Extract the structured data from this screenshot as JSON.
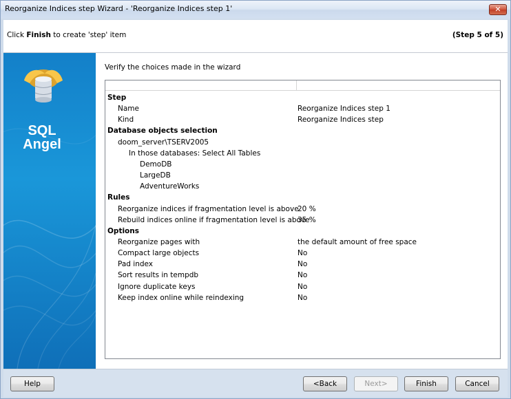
{
  "window": {
    "title": "Reorganize Indices step Wizard - 'Reorganize Indices step 1'",
    "close_glyph": "✕"
  },
  "header": {
    "instruction_prefix": "Click ",
    "instruction_bold": "Finish",
    "instruction_suffix": " to create 'step' item",
    "step_indicator": "(Step 5 of 5)"
  },
  "sidebar": {
    "logo_line1": "SQL",
    "logo_line2": "Angel",
    "logo_icon": "sql-angel-database-wings-icon"
  },
  "content": {
    "verify_text": "Verify the choices made in the wizard",
    "rows": [
      {
        "type": "section",
        "label": "Step",
        "value": ""
      },
      {
        "type": "lvl1",
        "label": "Name",
        "value": "Reorganize Indices step 1"
      },
      {
        "type": "lvl1",
        "label": "Kind",
        "value": "Reorganize Indices step"
      },
      {
        "type": "section",
        "label": "Database objects selection",
        "value": ""
      },
      {
        "type": "lvl1",
        "label": "doom_server\\TSERV2005",
        "value": ""
      },
      {
        "type": "lvl2",
        "label": "In those databases: Select All Tables",
        "value": ""
      },
      {
        "type": "lvl3",
        "label": "DemoDB",
        "value": ""
      },
      {
        "type": "lvl3",
        "label": "LargeDB",
        "value": ""
      },
      {
        "type": "lvl3",
        "label": "AdventureWorks",
        "value": ""
      },
      {
        "type": "section",
        "label": "Rules",
        "value": ""
      },
      {
        "type": "lvl1",
        "label": "Reorganize indices if fragmentation level is above",
        "value": "20 %"
      },
      {
        "type": "lvl1",
        "label": "Rebuild indices online if fragmentation level is above",
        "value": "35 %"
      },
      {
        "type": "section",
        "label": "Options",
        "value": ""
      },
      {
        "type": "lvl1",
        "label": "Reorganize pages with",
        "value": "the default amount of free space"
      },
      {
        "type": "lvl1",
        "label": "Compact large objects",
        "value": "No"
      },
      {
        "type": "lvl1",
        "label": "Pad index",
        "value": "No"
      },
      {
        "type": "lvl1",
        "label": "Sort results in tempdb",
        "value": "No"
      },
      {
        "type": "lvl1",
        "label": "Ignore duplicate keys",
        "value": "No"
      },
      {
        "type": "lvl1",
        "label": "Keep index online while reindexing",
        "value": "No"
      }
    ]
  },
  "footer": {
    "help_label": "Help",
    "back_label": "<Back",
    "next_label": "Next>",
    "finish_label": "Finish",
    "cancel_label": "Cancel"
  },
  "colors": {
    "sidebar_blue": "#1a97d9",
    "close_red": "#c13f27"
  }
}
